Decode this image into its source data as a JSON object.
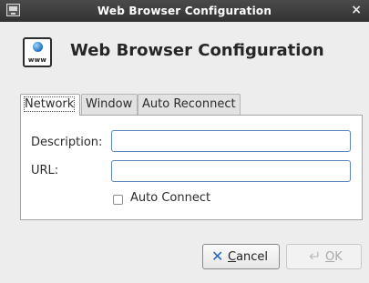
{
  "window": {
    "title": "Web Browser Configuration",
    "close_symbol": "×",
    "app_icon": "app-window-icon"
  },
  "header": {
    "icon": "www-globe-icon",
    "icon_caption": "www",
    "title": "Web Browser Configuration"
  },
  "tabs": [
    {
      "label": "Network",
      "active": true
    },
    {
      "label": "Window",
      "active": false
    },
    {
      "label": "Auto Reconnect",
      "active": false
    }
  ],
  "form": {
    "description_label": "Description:",
    "description_value": "",
    "url_label": "URL:",
    "url_value": "",
    "auto_connect_label": "Auto Connect",
    "auto_connect_checked": false
  },
  "buttons": {
    "cancel": {
      "mnemonic": "C",
      "rest": "ancel",
      "icon": "cancel-x-icon",
      "enabled": true
    },
    "ok": {
      "mnemonic": "O",
      "rest": "K",
      "icon": "enter-arrow-icon",
      "enabled": false
    }
  },
  "colors": {
    "titlebar": "#3a3a3a",
    "field_border": "#5a86b8",
    "cancel_icon": "#1f66c4"
  }
}
